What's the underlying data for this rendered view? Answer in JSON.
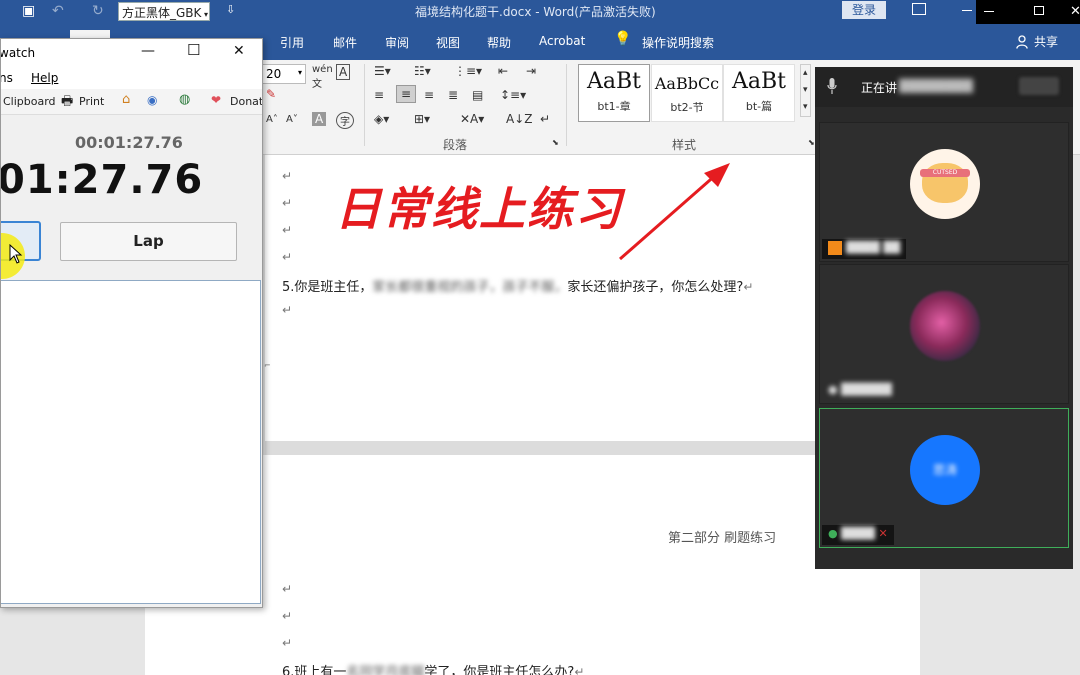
{
  "word": {
    "title_bar": {
      "font_name_value": "方正黑体_GBK",
      "document_title": "福境结构化题干.docx  -  Word(产品激活失败)",
      "login_label": "登录"
    },
    "tabs": [
      "引用",
      "邮件",
      "审阅",
      "视图",
      "帮助",
      "Acrobat"
    ],
    "tell_me": "操作说明搜索",
    "share": "共享",
    "ribbon": {
      "font_size_value": "20",
      "paragraph_group_label": "段落",
      "styles_group_label": "样式",
      "styles": [
        {
          "sample": "AaBt",
          "name": "bt1-章"
        },
        {
          "sample": "AaBbCc",
          "name": "bt2-节"
        },
        {
          "sample": "AaBt",
          "name": "bt-篇"
        }
      ]
    },
    "document": {
      "banner": "日常线上练习",
      "q5_prefix": "5.你是班主任，",
      "q5_blurred": "家长都很重视的孩子，孩子不服，",
      "q5_suffix": "家长还偏护孩子，你怎么处理?",
      "page_header": "第二部分   刷题练习",
      "q6_prefix": "6.班上有一",
      "q6_blurred": "名同学月底辍",
      "q6_suffix": "学了，你是班主任怎么办?",
      "para_mark": "↵"
    }
  },
  "stopwatch": {
    "title": "watch",
    "menu": [
      "ns",
      "Help"
    ],
    "toolbar": [
      "Clipboard",
      "Print",
      "Donate"
    ],
    "small_time": "00:01:27.76",
    "big_time": "01:27.76",
    "lap_label": "Lap"
  },
  "meeting": {
    "speaking_label": "正在讲",
    "participants": [
      {
        "avatar_text": "CUTSED"
      },
      {
        "avatar_text": ""
      },
      {
        "avatar_text": "思涛",
        "avatar_color": "#1677ff"
      }
    ]
  }
}
